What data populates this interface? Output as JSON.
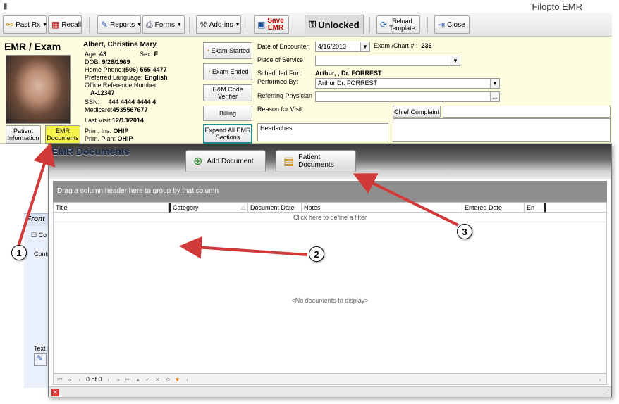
{
  "window": {
    "title": "Filopto EMR"
  },
  "toolbar": {
    "past_rx": "Past Rx",
    "recall": "Recall",
    "reports": "Reports",
    "forms": "Forms",
    "addins": "Add-ins",
    "save_line1": "Save",
    "save_line2": "EMR",
    "status": "Unlocked",
    "reload_line1": "Reload",
    "reload_line2": "Template",
    "close": "Close"
  },
  "patient": {
    "section_title": "EMR / Exam",
    "name": "Albert, Christina Mary",
    "age_label": "Age:",
    "age": "43",
    "sex_label": "Sex:",
    "sex": "F",
    "dob_label": "DOB:",
    "dob": "9/26/1969",
    "home_phone_label": "Home Phone:",
    "home_phone": "(506) 555-4477",
    "language_label": "Preferred Language:",
    "language": "English",
    "office_ref_label": "Office Reference Number",
    "office_ref": "A-12347",
    "ssn_label": "SSN:",
    "ssn": "444 4444 4444 4",
    "medicare_label": "Medicare:",
    "medicare": "4535567677",
    "last_visit_label": "Last Visit:",
    "last_visit": "12/13/2014",
    "prim_ins_label": "Prim. Ins:",
    "prim_ins": "OHIP",
    "prim_plan_label": "Prim. Plan:",
    "prim_plan": "OHIP",
    "btn_patient_info_1": "Patient",
    "btn_patient_info_2": "Information",
    "btn_emr_docs_1": "EMR",
    "btn_emr_docs_2": "Documents"
  },
  "exam": {
    "btn_started": "Exam Started",
    "btn_ended": "Exam Ended",
    "btn_em_1": "E&M Code",
    "btn_em_2": "Verifier",
    "btn_billing": "Billing",
    "btn_expand_1": "Expand All EMR",
    "btn_expand_2": "Sections",
    "date_label": "Date of Encounter:",
    "date_value": "4/16/2013",
    "chart_label": "Exam /Chart # :",
    "chart_value": "236",
    "place_label": "Place of Service",
    "place_value": "",
    "scheduled_label": "Scheduled For :",
    "scheduled_value": "Arthur, , Dr. FORREST",
    "performed_label": "Performed By:",
    "performed_value": "Arthur  Dr. FORREST",
    "referring_label": "Referring Physician",
    "referring_value": "",
    "reason_label": "Reason for Visit:",
    "reason_value": "Headaches",
    "chief_complaint_btn": "Chief Complaint"
  },
  "behind": {
    "front_tab": "Front",
    "checkbox_label": "Co",
    "cont_label": "Contr",
    "text_label": "Text I"
  },
  "documents": {
    "title": "EMR Documents",
    "add_btn": "Add Document",
    "patient_docs_btn": "Patient Documents",
    "group_hint": "Drag a column header here to group by that column",
    "columns": [
      "Title",
      "Category",
      "Document Date",
      "Notes",
      "Entered Date",
      "En"
    ],
    "filter_hint": "Click here to define a filter",
    "empty_text": "<No documents to display>",
    "pager_text": "0 of 0"
  },
  "callouts": [
    "1",
    "2",
    "3"
  ],
  "colors": {
    "header_bg": "#fdfde0",
    "arrow": "#d23a3a",
    "emr_docs_btn": "#f5f34a",
    "save": "#c00000"
  }
}
